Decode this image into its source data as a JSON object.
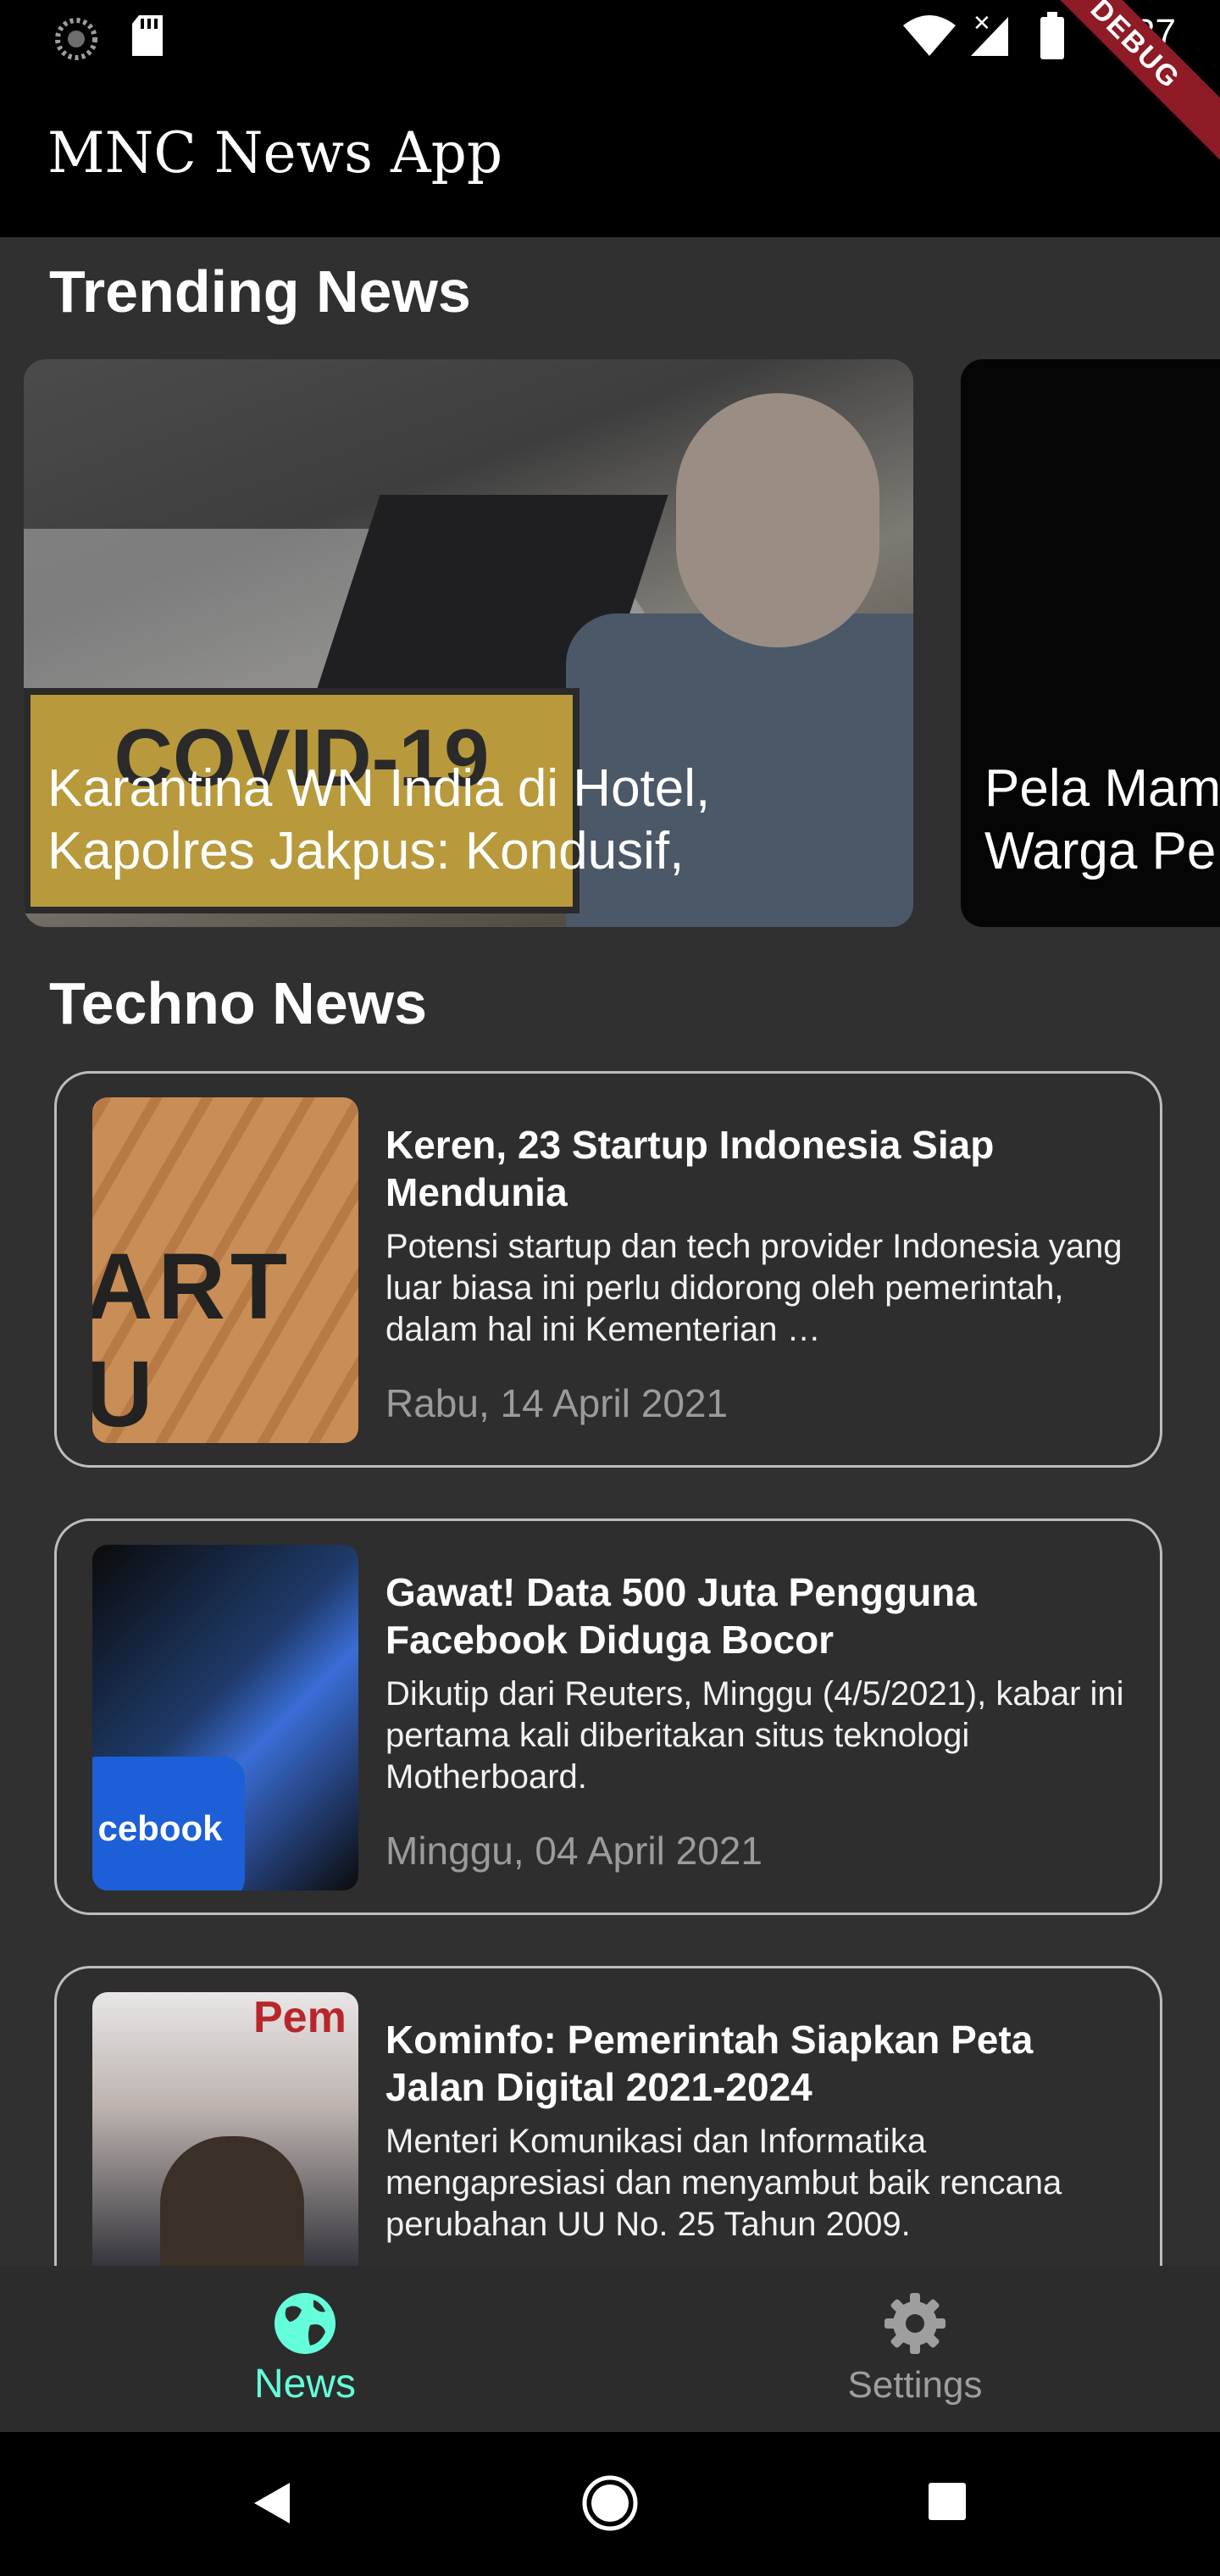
{
  "status_bar": {
    "time": "9:37",
    "icons": [
      "loading-icon",
      "sd-card-icon",
      "wifi-icon",
      "signal-icon",
      "battery-icon"
    ],
    "debug_banner": "DEBUG"
  },
  "app_bar": {
    "title": "MNC News App"
  },
  "trending": {
    "heading": "Trending News",
    "items": [
      {
        "title": "Karantina WN India di Hotel,\nKapolres Jakpus: Kondusif,",
        "image_text": "COVID-19"
      },
      {
        "title": "Pela Mam\nWarga Pe"
      }
    ]
  },
  "techno": {
    "heading": "Techno News",
    "items": [
      {
        "title": "Keren, 23 Startup Indonesia Siap Mendunia",
        "summary": "Potensi startup dan tech provider Indonesia yang luar biasa ini perlu didorong oleh pemerintah, dalam hal ini Kementerian …",
        "date": "Rabu, 14 April 2021",
        "image_text": "ART U"
      },
      {
        "title": "Gawat! Data 500 Juta Pengguna Facebook Diduga Bocor",
        "summary": "Dikutip dari Reuters, Minggu (4/5/2021), kabar ini pertama kali diberitakan situs teknologi Motherboard.",
        "date": "Minggu, 04 April 2021",
        "image_text": "cebook"
      },
      {
        "title": "Kominfo: Pemerintah Siapkan Peta Jalan Digital 2021-2024",
        "summary": "Menteri Komunikasi dan Informatika mengapresiasi dan menyambut baik rencana perubahan UU No. 25 Tahun 2009.",
        "image_text": "Pem"
      }
    ]
  },
  "bottom_nav": {
    "items": [
      {
        "label": "News",
        "icon": "globe-icon",
        "active": true
      },
      {
        "label": "Settings",
        "icon": "gear-icon",
        "active": false
      }
    ],
    "active_color": "#64ffda",
    "inactive_color": "#9e9e9e"
  },
  "system_nav": {
    "icons": [
      "back-icon",
      "home-icon",
      "recents-icon"
    ]
  }
}
